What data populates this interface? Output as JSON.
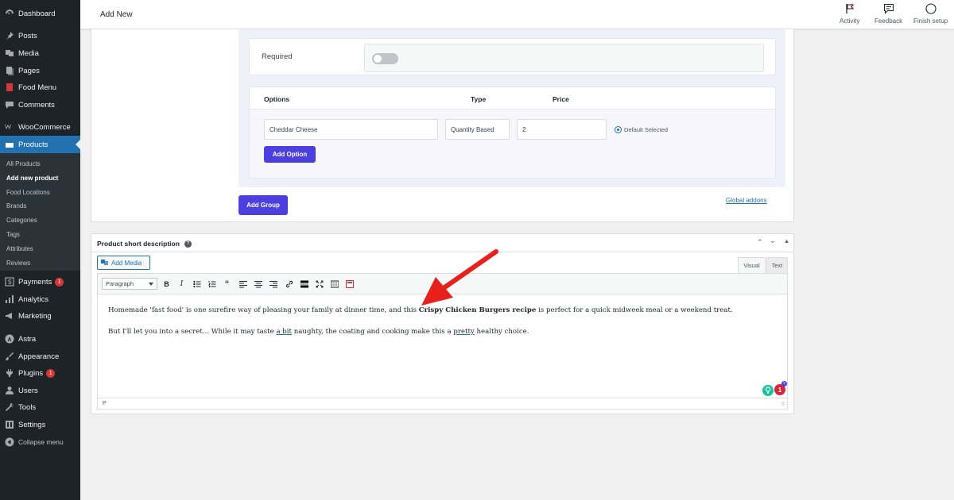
{
  "sidebar": {
    "items": [
      {
        "label": "Dashboard",
        "icon": "dashboard-icon"
      },
      {
        "label": "Posts",
        "icon": "pin-icon"
      },
      {
        "label": "Media",
        "icon": "media-icon"
      },
      {
        "label": "Pages",
        "icon": "pages-icon"
      },
      {
        "label": "Food Menu",
        "icon": "food-menu-icon"
      },
      {
        "label": "Comments",
        "icon": "comments-icon"
      },
      {
        "label": "WooCommerce",
        "icon": "woocommerce-icon"
      },
      {
        "label": "Products",
        "icon": "products-icon"
      },
      {
        "label": "Payments",
        "icon": "payments-icon",
        "badge": "1"
      },
      {
        "label": "Analytics",
        "icon": "analytics-icon"
      },
      {
        "label": "Marketing",
        "icon": "marketing-icon"
      },
      {
        "label": "Astra",
        "icon": "astra-icon"
      },
      {
        "label": "Appearance",
        "icon": "appearance-icon"
      },
      {
        "label": "Plugins",
        "icon": "plugins-icon",
        "badge": "1"
      },
      {
        "label": "Users",
        "icon": "users-icon"
      },
      {
        "label": "Tools",
        "icon": "tools-icon"
      },
      {
        "label": "Settings",
        "icon": "settings-icon"
      },
      {
        "label": "Collapse menu",
        "icon": "collapse-icon"
      }
    ],
    "submenu": [
      "All Products",
      "Add new product",
      "Food Locations",
      "Brands",
      "Categories",
      "Tags",
      "Attributes",
      "Reviews"
    ]
  },
  "topbar": {
    "title": "Add New",
    "actions": [
      "Activity",
      "Feedback",
      "Finish setup"
    ]
  },
  "group": {
    "required_label": "Required",
    "required_on": false,
    "options_header": {
      "options": "Options",
      "type": "Type",
      "price": "Price"
    },
    "option_row": {
      "name": "Cheddar Cheese",
      "type": "Quantity Based",
      "price": "2",
      "default_label": "Default Selected"
    },
    "add_option": "Add Option",
    "add_group": "Add Group",
    "global_addons": "Global addons"
  },
  "short_description": {
    "title": "Product short description",
    "help": "?",
    "add_media": "Add Media",
    "tabs": {
      "visual": "Visual",
      "text": "Text"
    },
    "format": "Paragraph",
    "para1_before": "Homemade 'fast food' is one surefire way of pleasing your family at dinner time, and this ",
    "para1_bold": "Crispy Chicken Burgers recipe",
    "para1_after": " is perfect for a quick midweek meal or a weekend treat.",
    "para2_a": "But I'll let you into a secret... While it may taste ",
    "para2_b": "a bit",
    "para2_c": " naughty, the coating and cooking make this a ",
    "para2_d": "pretty",
    "para2_e": " healthy choice.",
    "status_path": "P",
    "grammarly_count": "1"
  },
  "colors": {
    "sidebar": "#1d2327",
    "active": "#2271b1",
    "button": "#4c3fe0",
    "arrow": "#e8201c"
  }
}
